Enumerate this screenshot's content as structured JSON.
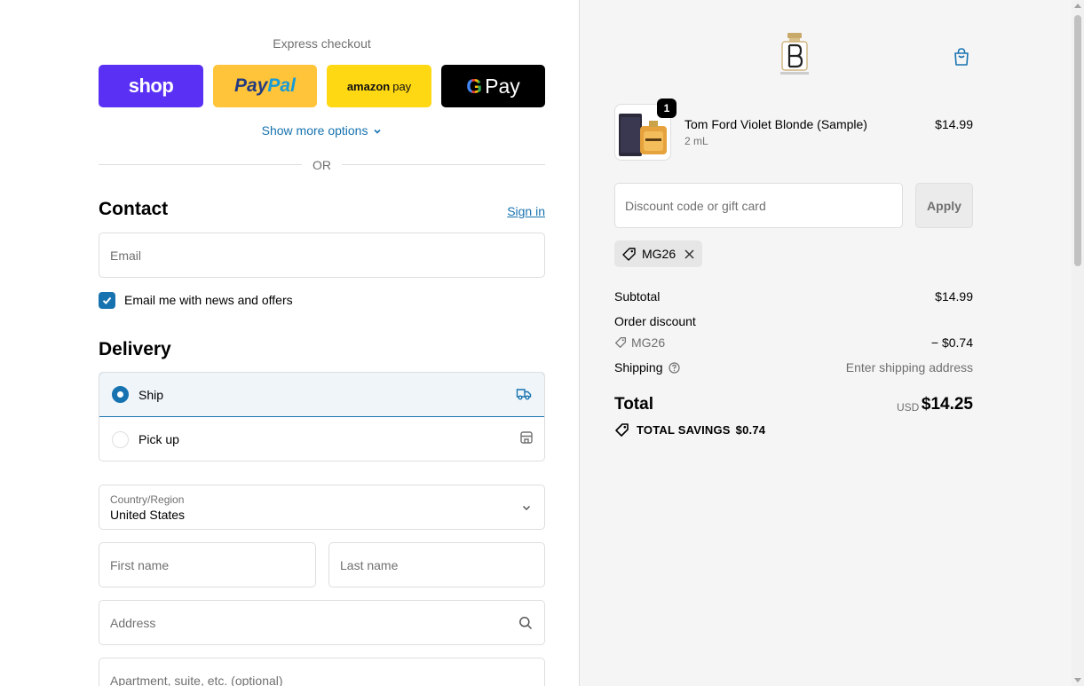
{
  "express": {
    "title": "Express checkout",
    "shop_label": "shop",
    "paypal_pay": "Pay",
    "paypal_pal": "Pal",
    "amazon_label": "amazon",
    "amazon_pay": "pay",
    "gpay_g": "G",
    "gpay_label": "Pay",
    "more_options": "Show more options",
    "or": "OR"
  },
  "contact": {
    "heading": "Contact",
    "signin": "Sign in",
    "email_placeholder": "Email",
    "newsletter_label": "Email me with news and offers",
    "newsletter_checked": true
  },
  "delivery": {
    "heading": "Delivery",
    "options": [
      {
        "label": "Ship",
        "selected": true
      },
      {
        "label": "Pick up",
        "selected": false
      }
    ],
    "country_label": "Country/Region",
    "country_value": "United States",
    "first_name_placeholder": "First name",
    "last_name_placeholder": "Last name",
    "address_placeholder": "Address",
    "apt_placeholder": "Apartment, suite, etc. (optional)"
  },
  "summary": {
    "product": {
      "name": "Tom Ford Violet Blonde (Sample)",
      "variant": "2 mL",
      "price": "$14.99",
      "quantity": "1"
    },
    "discount_placeholder": "Discount code or gift card",
    "apply_label": "Apply",
    "applied_code": "MG26",
    "subtotal_label": "Subtotal",
    "subtotal_value": "$14.99",
    "order_discount_label": "Order discount",
    "order_discount_code": "MG26",
    "order_discount_value": "− $0.74",
    "shipping_label": "Shipping",
    "shipping_value": "Enter shipping address",
    "total_label": "Total",
    "total_currency": "USD",
    "total_value": "$14.25",
    "savings_label": "TOTAL SAVINGS",
    "savings_value": "$0.74"
  },
  "colors": {
    "accent": "#1773b0",
    "shop": "#5a31f4",
    "paypal": "#ffc439",
    "amazon": "#ffd814",
    "gpay": "#000000",
    "summary_bg": "#f5f5f5"
  },
  "icons": [
    "chevron-down-icon",
    "truck-icon",
    "store-icon",
    "search-icon",
    "shopping-bag-icon",
    "tag-icon",
    "close-icon",
    "help-circle-icon",
    "checkmark-icon"
  ]
}
